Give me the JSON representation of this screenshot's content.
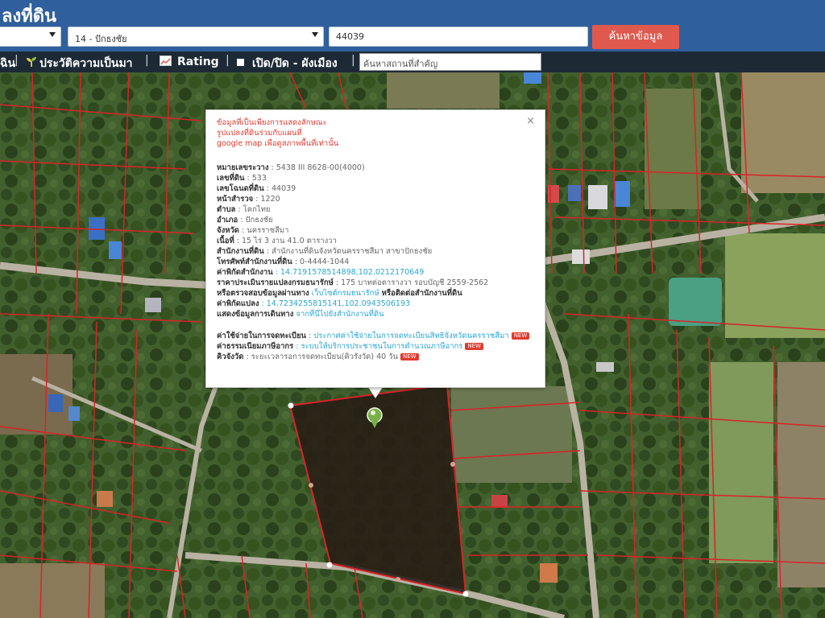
{
  "header": {
    "title": "ลงที่ดิน",
    "province_select": "",
    "district_select": "14 - ปักธงชัย",
    "parcel_input": "44039",
    "search_button": "ค้นหาข้อมูล"
  },
  "toolbar": {
    "item_partial": "ฉิน",
    "history_label": "ประวัติความเป็นมา",
    "rating_label": "Rating",
    "toggle_label": "เปิด/ปิด - ผังเมือง",
    "place_search_placeholder": "ค้นหาสถานที่สำคัญ",
    "separator": "|"
  },
  "popup": {
    "close_label": "×",
    "note_line1": "ข้อมูลที่เป็นเพียงการแสดงลักษณะ",
    "note_line2": "รูปแปลงที่ดินร่วมกับแผนที่",
    "note_line3": "google map เพื่อดูสภาพพื้นที่เท่านั้น",
    "fields": {
      "map_sheet_label": "หมายเลขระวาง",
      "map_sheet_value": ": 5438 III 8628-00(4000)",
      "land_no_label": "เลขที่ดิน",
      "land_no_value": ": 533",
      "deed_no_label": "เลขโฉนดที่ดิน",
      "deed_no_value": ": 44039",
      "survey_page_label": "หน้าสำรวจ",
      "survey_page_value": ": 1220",
      "subdistrict_label": "ตำบล",
      "subdistrict_value": ": โคกไทย",
      "district_label": "อำเภอ",
      "district_value": ": ปักธงชัย",
      "province_label": "จังหวัด",
      "province_value": ": นครราชสีมา",
      "area_label": "เนื้อที่",
      "area_value": ": 15 ไร่ 3 งาน 41.0 ตารางวา",
      "office_label": "สำนักงานที่ดิน",
      "office_value": ": สำนักงานที่ดินจังหวัดนครราชสีมา สาขาปักธงชัย",
      "phone_label": "โทรศัพท์สำนักงานที่ดิน",
      "phone_value": ": 0-4444-1044",
      "office_coord_label": "ค่าพิกัดสำนักงาน",
      "office_coord_value": ": 14.7191578514898,102.0212170649",
      "price_label": "ราคาประเมินรายแปลงกรมธนารักษ์",
      "price_value": ": 175 บาทต่อตารางวา รอบบัญชี 2559-2562",
      "check_label": "หรือตรวจสอบข้อมูลผ่านทาง",
      "check_link": "เว็บไซต์กรมธนารักษ์",
      "check_suffix": "หรือติดต่อสำนักงานที่ดิน",
      "parcel_coord_label": "ค่าพิกัดแปลง",
      "parcel_coord_value": ": 14.7234255815141,102.0943506193",
      "route_label": "แสดงข้อมูลการเดินทาง",
      "route_link": "จากที่นี่ไปยังสำนักงานที่ดิน",
      "reg_fee_label": "ค่าใช้จ่ายในการจดทะเบียน",
      "reg_fee_link": ": ประกาศค่าใช้จ่ายในการจดทะเบียนสิทธิจังหวัดนครราชสีมา",
      "tax_label": "ค่าธรรมเนียมภาษีอากร",
      "tax_link": ": ระบบให้บริการประชาชนในการคำนวณภาษีอากร",
      "queue_label": "คิวจังวัด",
      "queue_value": ": ระยะเวลารอการจดทะเบียน(คิวรังวัด) 40 วัน",
      "new_badge": "NEW"
    }
  },
  "colors": {
    "header_bg": "#2f5f9c",
    "toolbar_bg": "#1d2a36",
    "search_button": "#e0594e",
    "parcel_boundary": "#d8232a",
    "link": "#2aa6d6",
    "note": "#e23a2e"
  }
}
